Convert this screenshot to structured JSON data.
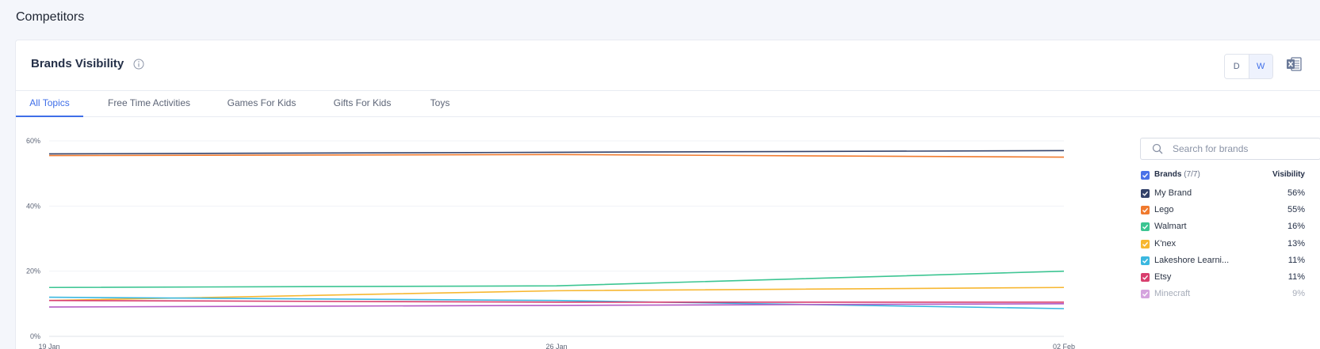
{
  "page": {
    "title": "Competitors"
  },
  "card": {
    "title": "Brands Visibility",
    "toggles": [
      {
        "label": "D",
        "active": false
      },
      {
        "label": "W",
        "active": true
      }
    ]
  },
  "tabs": [
    {
      "label": "All Topics",
      "active": true
    },
    {
      "label": "Free Time Activities",
      "active": false
    },
    {
      "label": "Games For Kids",
      "active": false
    },
    {
      "label": "Gifts For Kids",
      "active": false
    },
    {
      "label": "Toys",
      "active": false
    }
  ],
  "legend": {
    "search_placeholder": "Search for brands",
    "header_label": "Brands",
    "header_count": "(7/7)",
    "header_value": "Visibility",
    "header_color": "#4a72e8",
    "items": [
      {
        "name": "My Brand",
        "value": "56%",
        "color": "#33426a"
      },
      {
        "name": "Lego",
        "value": "55%",
        "color": "#f07a2e"
      },
      {
        "name": "Walmart",
        "value": "16%",
        "color": "#3cc592"
      },
      {
        "name": "K'nex",
        "value": "13%",
        "color": "#f7b731"
      },
      {
        "name": "Lakeshore Learni...",
        "value": "11%",
        "color": "#3bb8e0"
      },
      {
        "name": "Etsy",
        "value": "11%",
        "color": "#d83f6e"
      },
      {
        "name": "Minecraft",
        "value": "9%",
        "color": "#b35bc4",
        "faded": true
      }
    ]
  },
  "chart_data": {
    "type": "line",
    "x": [
      "19 Jan",
      "26 Jan",
      "02 Feb"
    ],
    "ylim": [
      0,
      60
    ],
    "yticks": [
      "0%",
      "20%",
      "40%",
      "60%"
    ],
    "grid": true,
    "legend_placement": "right",
    "series": [
      {
        "name": "My Brand",
        "color": "#33426a",
        "values": [
          56,
          56.5,
          57
        ]
      },
      {
        "name": "Lego",
        "color": "#f07a2e",
        "values": [
          55.5,
          55.8,
          55
        ]
      },
      {
        "name": "Walmart",
        "color": "#3cc592",
        "values": [
          15,
          15.5,
          20
        ]
      },
      {
        "name": "K'nex",
        "color": "#f7b731",
        "values": [
          11,
          14,
          15
        ]
      },
      {
        "name": "Lakeshore Learni...",
        "color": "#3bb8e0",
        "values": [
          12,
          11,
          8.5
        ]
      },
      {
        "name": "Etsy",
        "color": "#d83f6e",
        "values": [
          11,
          10.5,
          10.5
        ]
      },
      {
        "name": "Minecraft",
        "color": "#b35bc4",
        "values": [
          9,
          9.5,
          10
        ]
      }
    ]
  }
}
